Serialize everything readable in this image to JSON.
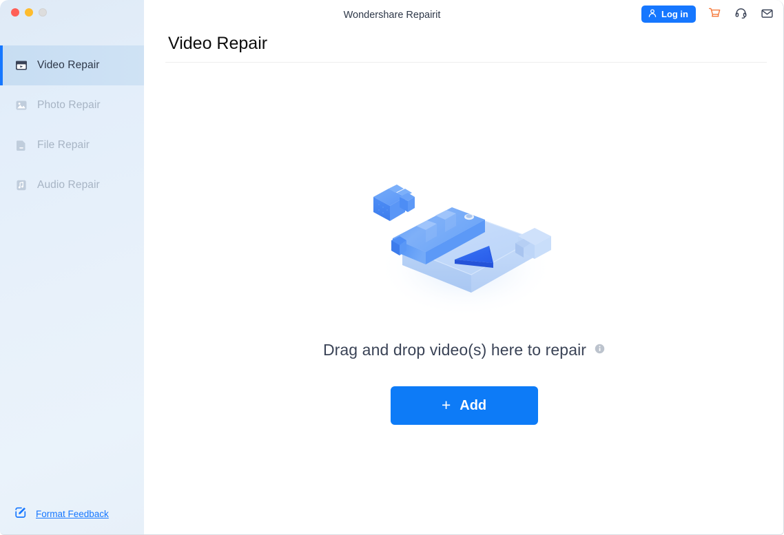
{
  "window": {
    "traffic_lights": [
      {
        "name": "close",
        "color": "#ff5f57"
      },
      {
        "name": "minimize",
        "color": "#febc2e"
      },
      {
        "name": "maximize",
        "color": "#dddddd"
      }
    ]
  },
  "header": {
    "app_title": "Wondershare Repairit",
    "login_label": "Log in",
    "login_icon": "user-icon",
    "icons": [
      {
        "name": "cart-icon",
        "color": "#f5793b"
      },
      {
        "name": "headset-icon",
        "color": "#3a4356"
      },
      {
        "name": "mail-icon",
        "color": "#3a4356"
      }
    ]
  },
  "sidebar": {
    "items": [
      {
        "label": "Video Repair",
        "icon": "video-repair-icon",
        "active": true
      },
      {
        "label": "Photo Repair",
        "icon": "photo-repair-icon",
        "active": false
      },
      {
        "label": "File Repair",
        "icon": "file-repair-icon",
        "active": false
      },
      {
        "label": "Audio Repair",
        "icon": "audio-repair-icon",
        "active": false
      }
    ],
    "footer": {
      "label": "Format Feedback",
      "icon": "edit-square-icon"
    },
    "accent_color": "#1677ff",
    "active_bg": "#cbe0f4"
  },
  "main": {
    "page_title": "Video Repair",
    "dropzone": {
      "illustration": "video-clapperboard-puzzle-illustration",
      "drop_text": "Drag and drop video(s) here to repair",
      "info_icon": "info-icon",
      "add_button_label": "Add",
      "add_button_icon": "plus-icon",
      "add_button_color": "#0d7bf7"
    }
  }
}
